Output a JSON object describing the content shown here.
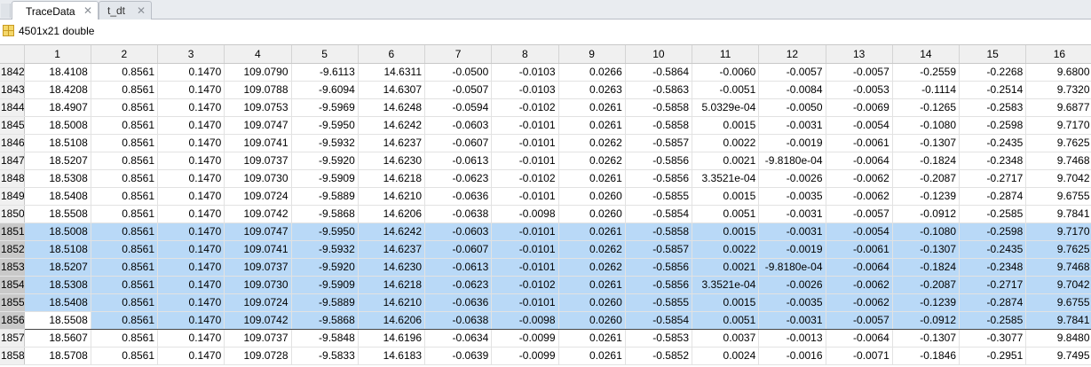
{
  "tabs": [
    {
      "label": "TraceData",
      "active": true,
      "close": "✕"
    },
    {
      "label": "t_dt",
      "active": false,
      "close": "✕"
    }
  ],
  "variable_info": "4501x21 double",
  "columns": [
    "1",
    "2",
    "3",
    "4",
    "5",
    "6",
    "7",
    "8",
    "9",
    "10",
    "11",
    "12",
    "13",
    "14",
    "15",
    "16"
  ],
  "rows": [
    {
      "index": "1842",
      "values": [
        "18.4108",
        "0.8561",
        "0.1470",
        "109.0790",
        "-9.6113",
        "14.6311",
        "-0.0500",
        "-0.0103",
        "0.0266",
        "-0.5864",
        "-0.0060",
        "-0.0057",
        "-0.0057",
        "-0.2559",
        "-0.2268",
        "9.6800"
      ]
    },
    {
      "index": "1843",
      "values": [
        "18.4208",
        "0.8561",
        "0.1470",
        "109.0788",
        "-9.6094",
        "14.6307",
        "-0.0507",
        "-0.0103",
        "0.0263",
        "-0.5863",
        "-0.0051",
        "-0.0084",
        "-0.0053",
        "-0.1114",
        "-0.2514",
        "9.7320"
      ]
    },
    {
      "index": "1844",
      "values": [
        "18.4907",
        "0.8561",
        "0.1470",
        "109.0753",
        "-9.5969",
        "14.6248",
        "-0.0594",
        "-0.0102",
        "0.0261",
        "-0.5858",
        "5.0329e-04",
        "-0.0050",
        "-0.0069",
        "-0.1265",
        "-0.2583",
        "9.6877"
      ]
    },
    {
      "index": "1845",
      "values": [
        "18.5008",
        "0.8561",
        "0.1470",
        "109.0747",
        "-9.5950",
        "14.6242",
        "-0.0603",
        "-0.0101",
        "0.0261",
        "-0.5858",
        "0.0015",
        "-0.0031",
        "-0.0054",
        "-0.1080",
        "-0.2598",
        "9.7170"
      ]
    },
    {
      "index": "1846",
      "values": [
        "18.5108",
        "0.8561",
        "0.1470",
        "109.0741",
        "-9.5932",
        "14.6237",
        "-0.0607",
        "-0.0101",
        "0.0262",
        "-0.5857",
        "0.0022",
        "-0.0019",
        "-0.0061",
        "-0.1307",
        "-0.2435",
        "9.7625"
      ]
    },
    {
      "index": "1847",
      "values": [
        "18.5207",
        "0.8561",
        "0.1470",
        "109.0737",
        "-9.5920",
        "14.6230",
        "-0.0613",
        "-0.0101",
        "0.0262",
        "-0.5856",
        "0.0021",
        "-9.8180e-04",
        "-0.0064",
        "-0.1824",
        "-0.2348",
        "9.7468"
      ]
    },
    {
      "index": "1848",
      "values": [
        "18.5308",
        "0.8561",
        "0.1470",
        "109.0730",
        "-9.5909",
        "14.6218",
        "-0.0623",
        "-0.0102",
        "0.0261",
        "-0.5856",
        "3.3521e-04",
        "-0.0026",
        "-0.0062",
        "-0.2087",
        "-0.2717",
        "9.7042"
      ]
    },
    {
      "index": "1849",
      "values": [
        "18.5408",
        "0.8561",
        "0.1470",
        "109.0724",
        "-9.5889",
        "14.6210",
        "-0.0636",
        "-0.0101",
        "0.0260",
        "-0.5855",
        "0.0015",
        "-0.0035",
        "-0.0062",
        "-0.1239",
        "-0.2874",
        "9.6755"
      ]
    },
    {
      "index": "1850",
      "values": [
        "18.5508",
        "0.8561",
        "0.1470",
        "109.0742",
        "-9.5868",
        "14.6206",
        "-0.0638",
        "-0.0098",
        "0.0260",
        "-0.5854",
        "0.0051",
        "-0.0031",
        "-0.0057",
        "-0.0912",
        "-0.2585",
        "9.7841"
      ]
    },
    {
      "index": "1851",
      "values": [
        "18.5008",
        "0.8561",
        "0.1470",
        "109.0747",
        "-9.5950",
        "14.6242",
        "-0.0603",
        "-0.0101",
        "0.0261",
        "-0.5858",
        "0.0015",
        "-0.0031",
        "-0.0054",
        "-0.1080",
        "-0.2598",
        "9.7170"
      ],
      "selected": true
    },
    {
      "index": "1852",
      "values": [
        "18.5108",
        "0.8561",
        "0.1470",
        "109.0741",
        "-9.5932",
        "14.6237",
        "-0.0607",
        "-0.0101",
        "0.0262",
        "-0.5857",
        "0.0022",
        "-0.0019",
        "-0.0061",
        "-0.1307",
        "-0.2435",
        "9.7625"
      ],
      "selected": true
    },
    {
      "index": "1853",
      "values": [
        "18.5207",
        "0.8561",
        "0.1470",
        "109.0737",
        "-9.5920",
        "14.6230",
        "-0.0613",
        "-0.0101",
        "0.0262",
        "-0.5856",
        "0.0021",
        "-9.8180e-04",
        "-0.0064",
        "-0.1824",
        "-0.2348",
        "9.7468"
      ],
      "selected": true
    },
    {
      "index": "1854",
      "values": [
        "18.5308",
        "0.8561",
        "0.1470",
        "109.0730",
        "-9.5909",
        "14.6218",
        "-0.0623",
        "-0.0102",
        "0.0261",
        "-0.5856",
        "3.3521e-04",
        "-0.0026",
        "-0.0062",
        "-0.2087",
        "-0.2717",
        "9.7042"
      ],
      "selected": true
    },
    {
      "index": "1855",
      "values": [
        "18.5408",
        "0.8561",
        "0.1470",
        "109.0724",
        "-9.5889",
        "14.6210",
        "-0.0636",
        "-0.0101",
        "0.0260",
        "-0.5855",
        "0.0015",
        "-0.0035",
        "-0.0062",
        "-0.1239",
        "-0.2874",
        "9.6755"
      ],
      "selected": true
    },
    {
      "index": "1856",
      "values": [
        "18.5508",
        "0.8561",
        "0.1470",
        "109.0742",
        "-9.5868",
        "14.6206",
        "-0.0638",
        "-0.0098",
        "0.0260",
        "-0.5854",
        "0.0051",
        "-0.0031",
        "-0.0057",
        "-0.0912",
        "-0.2585",
        "9.7841"
      ],
      "selected": true,
      "current_col": 0
    },
    {
      "index": "1857",
      "values": [
        "18.5607",
        "0.8561",
        "0.1470",
        "109.0737",
        "-9.5848",
        "14.6196",
        "-0.0634",
        "-0.0099",
        "0.0261",
        "-0.5853",
        "0.0037",
        "-0.0013",
        "-0.0064",
        "-0.1307",
        "-0.3077",
        "9.8480"
      ]
    },
    {
      "index": "1858",
      "values": [
        "18.5708",
        "0.8561",
        "0.1470",
        "109.0728",
        "-9.5833",
        "14.6183",
        "-0.0639",
        "-0.0099",
        "0.0261",
        "-0.5852",
        "0.0024",
        "-0.0016",
        "-0.0071",
        "-0.1846",
        "-0.2951",
        "9.7495"
      ]
    }
  ],
  "colors": {
    "selection": "#b9d9f7",
    "header": "#f0f0f0"
  }
}
